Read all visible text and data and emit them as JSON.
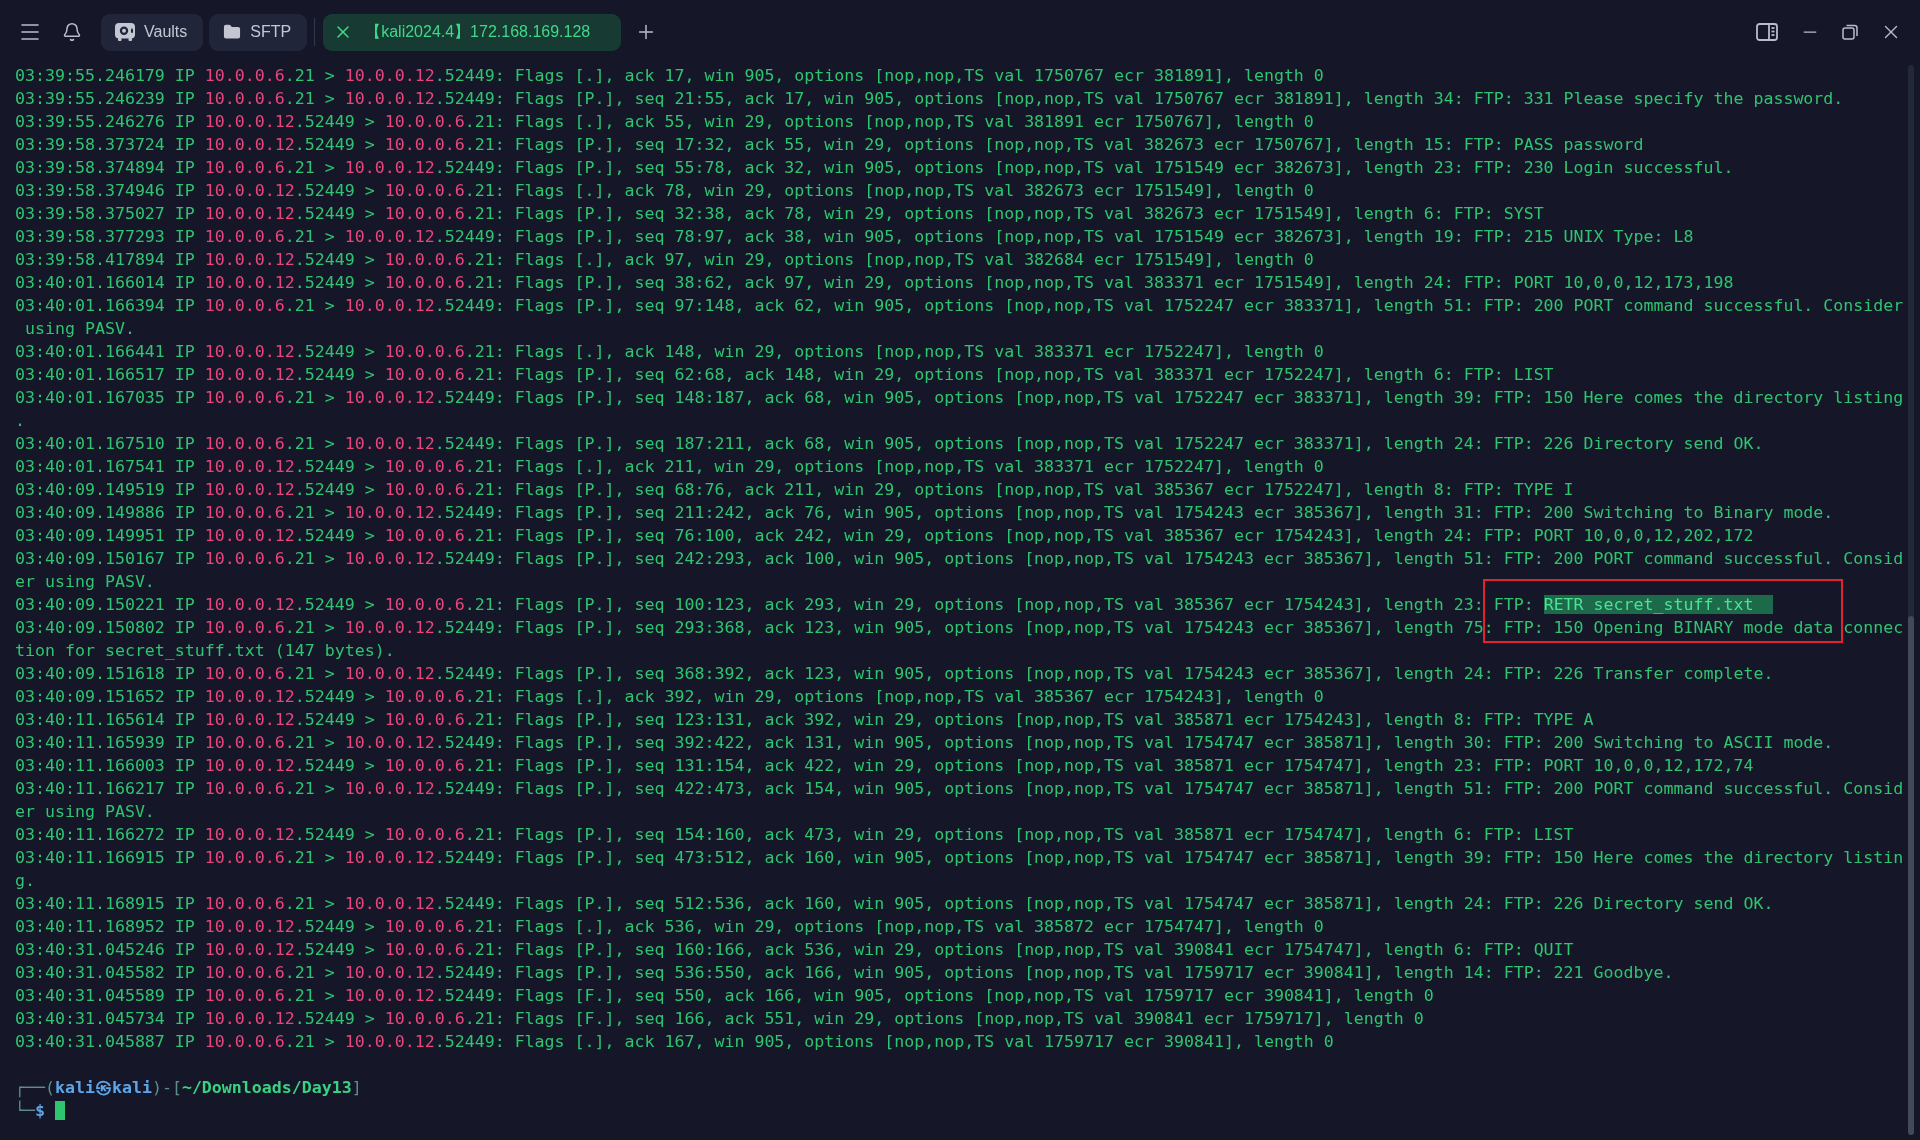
{
  "toolbar": {
    "buttons": [
      {
        "label": "Vaults",
        "kind": "vault"
      },
      {
        "label": "SFTP",
        "kind": "folder"
      }
    ]
  },
  "tabs": [
    {
      "label": "【kali2024.4】172.168.169.128",
      "selected": true
    }
  ],
  "terminal": {
    "lines": [
      {
        "time": "03:39:55.246179",
        "proto": "IP",
        "src_host": "10.0.0.6",
        "src_port": ".21",
        "arrow": ">",
        "dst_host": "10.0.0.12",
        "dst_port": ".52449:",
        "info": "Flags [.], ack 17, win 905, options [nop,nop,TS val 1750767 ecr 381891], length 0",
        "boxed": false
      },
      {
        "time": "03:39:55.246239",
        "proto": "IP",
        "src_host": "10.0.0.6",
        "src_port": ".21",
        "arrow": ">",
        "dst_host": "10.0.0.12",
        "dst_port": ".52449:",
        "info": "Flags [P.], seq 21:55, ack 17, win 905, options [nop,nop,TS val 1750767 ecr 381891], length 34: FTP: 331 Please specify the password.",
        "boxed": false
      },
      {
        "time": "03:39:55.246276",
        "proto": "IP",
        "src_host": "10.0.0.12",
        "src_port": ".52449",
        "arrow": ">",
        "dst_host": "10.0.0.6",
        "dst_port": ".21:",
        "info": "Flags [.], ack 55, win 29, options [nop,nop,TS val 381891 ecr 1750767], length 0",
        "boxed": false
      },
      {
        "time": "03:39:58.373724",
        "proto": "IP",
        "src_host": "10.0.0.12",
        "src_port": ".52449",
        "arrow": ">",
        "dst_host": "10.0.0.6",
        "dst_port": ".21:",
        "info": "Flags [P.], seq 17:32, ack 55, win 29, options [nop,nop,TS val 382673 ecr 1750767], length 15: FTP: PASS password",
        "boxed": false
      },
      {
        "time": "03:39:58.374894",
        "proto": "IP",
        "src_host": "10.0.0.6",
        "src_port": ".21",
        "arrow": ">",
        "dst_host": "10.0.0.12",
        "dst_port": ".52449:",
        "info": "Flags [P.], seq 55:78, ack 32, win 905, options [nop,nop,TS val 1751549 ecr 382673], length 23: FTP: 230 Login successful.",
        "boxed": false
      },
      {
        "time": "03:39:58.374946",
        "proto": "IP",
        "src_host": "10.0.0.12",
        "src_port": ".52449",
        "arrow": ">",
        "dst_host": "10.0.0.6",
        "dst_port": ".21:",
        "info": "Flags [.], ack 78, win 29, options [nop,nop,TS val 382673 ecr 1751549], length 0",
        "boxed": false
      },
      {
        "time": "03:39:58.375027",
        "proto": "IP",
        "src_host": "10.0.0.12",
        "src_port": ".52449",
        "arrow": ">",
        "dst_host": "10.0.0.6",
        "dst_port": ".21:",
        "info": "Flags [P.], seq 32:38, ack 78, win 29, options [nop,nop,TS val 382673 ecr 1751549], length 6: FTP: SYST",
        "boxed": false
      },
      {
        "time": "03:39:58.377293",
        "proto": "IP",
        "src_host": "10.0.0.6",
        "src_port": ".21",
        "arrow": ">",
        "dst_host": "10.0.0.12",
        "dst_port": ".52449:",
        "info": "Flags [P.], seq 78:97, ack 38, win 905, options [nop,nop,TS val 1751549 ecr 382673], length 19: FTP: 215 UNIX Type: L8",
        "boxed": false
      },
      {
        "time": "03:39:58.417894",
        "proto": "IP",
        "src_host": "10.0.0.12",
        "src_port": ".52449",
        "arrow": ">",
        "dst_host": "10.0.0.6",
        "dst_port": ".21:",
        "info": "Flags [.], ack 97, win 29, options [nop,nop,TS val 382684 ecr 1751549], length 0",
        "boxed": false
      },
      {
        "time": "03:40:01.166014",
        "proto": "IP",
        "src_host": "10.0.0.12",
        "src_port": ".52449",
        "arrow": ">",
        "dst_host": "10.0.0.6",
        "dst_port": ".21:",
        "info": "Flags [P.], seq 38:62, ack 97, win 29, options [nop,nop,TS val 383371 ecr 1751549], length 24: FTP: PORT 10,0,0,12,173,198",
        "boxed": false
      },
      {
        "time": "03:40:01.166394",
        "proto": "IP",
        "src_host": "10.0.0.6",
        "src_port": ".21",
        "arrow": ">",
        "dst_host": "10.0.0.12",
        "dst_port": ".52449:",
        "info": "Flags [P.], seq 97:148, ack 62, win 905, options [nop,nop,TS val 1752247 ecr 383371], length 51: FTP: 200 PORT command successful. Consider using PASV.",
        "boxed": false
      },
      {
        "time": "03:40:01.166441",
        "proto": "IP",
        "src_host": "10.0.0.12",
        "src_port": ".52449",
        "arrow": ">",
        "dst_host": "10.0.0.6",
        "dst_port": ".21:",
        "info": "Flags [.], ack 148, win 29, options [nop,nop,TS val 383371 ecr 1752247], length 0",
        "boxed": false
      },
      {
        "time": "03:40:01.166517",
        "proto": "IP",
        "src_host": "10.0.0.12",
        "src_port": ".52449",
        "arrow": ">",
        "dst_host": "10.0.0.6",
        "dst_port": ".21:",
        "info": "Flags [P.], seq 62:68, ack 148, win 29, options [nop,nop,TS val 383371 ecr 1752247], length 6: FTP: LIST",
        "boxed": false
      },
      {
        "time": "03:40:01.167035",
        "proto": "IP",
        "src_host": "10.0.0.6",
        "src_port": ".21",
        "arrow": ">",
        "dst_host": "10.0.0.12",
        "dst_port": ".52449:",
        "info": "Flags [P.], seq 148:187, ack 68, win 905, options [nop,nop,TS val 1752247 ecr 383371], length 39: FTP: 150 Here comes the directory listing.",
        "boxed": false
      },
      {
        "time": "03:40:01.167510",
        "proto": "IP",
        "src_host": "10.0.0.6",
        "src_port": ".21",
        "arrow": ">",
        "dst_host": "10.0.0.12",
        "dst_port": ".52449:",
        "info": "Flags [P.], seq 187:211, ack 68, win 905, options [nop,nop,TS val 1752247 ecr 383371], length 24: FTP: 226 Directory send OK.",
        "boxed": false
      },
      {
        "time": "03:40:01.167541",
        "proto": "IP",
        "src_host": "10.0.0.12",
        "src_port": ".52449",
        "arrow": ">",
        "dst_host": "10.0.0.6",
        "dst_port": ".21:",
        "info": "Flags [.], ack 211, win 29, options [nop,nop,TS val 383371 ecr 1752247], length 0",
        "boxed": false
      },
      {
        "time": "03:40:09.149519",
        "proto": "IP",
        "src_host": "10.0.0.12",
        "src_port": ".52449",
        "arrow": ">",
        "dst_host": "10.0.0.6",
        "dst_port": ".21:",
        "info": "Flags [P.], seq 68:76, ack 211, win 29, options [nop,nop,TS val 385367 ecr 1752247], length 8: FTP: TYPE I",
        "boxed": false
      },
      {
        "time": "03:40:09.149886",
        "proto": "IP",
        "src_host": "10.0.0.6",
        "src_port": ".21",
        "arrow": ">",
        "dst_host": "10.0.0.12",
        "dst_port": ".52449:",
        "info": "Flags [P.], seq 211:242, ack 76, win 905, options [nop,nop,TS val 1754243 ecr 385367], length 31: FTP: 200 Switching to Binary mode.",
        "boxed": false
      },
      {
        "time": "03:40:09.149951",
        "proto": "IP",
        "src_host": "10.0.0.12",
        "src_port": ".52449",
        "arrow": ">",
        "dst_host": "10.0.0.6",
        "dst_port": ".21:",
        "info": "Flags [P.], seq 76:100, ack 242, win 29, options [nop,nop,TS val 385367 ecr 1754243], length 24: FTP: PORT 10,0,0,12,202,172",
        "boxed": false
      },
      {
        "time": "03:40:09.150167",
        "proto": "IP",
        "src_host": "10.0.0.6",
        "src_port": ".21",
        "arrow": ">",
        "dst_host": "10.0.0.12",
        "dst_port": ".52449:",
        "info": "Flags [P.], seq 242:293, ack 100, win 905, options [nop,nop,TS val 1754243 ecr 385367], length 51: FTP: 200 PORT command successful. Consider using PASV.",
        "boxed": false
      },
      {
        "time": "03:40:09.150221",
        "proto": "IP",
        "src_host": "10.0.0.12",
        "src_port": ".52449",
        "arrow": ">",
        "dst_host": "10.0.0.6",
        "dst_port": ".21:",
        "info": "Flags [P.], seq 100:123, ack 293, win 29, options [nop,nop,TS val 385367 ecr 1754243], length 23: FTP:",
        "selected_text": "RETR secret_stuff.txt",
        "boxed": true
      },
      {
        "time": "03:40:09.150802",
        "proto": "IP",
        "src_host": "10.0.0.6",
        "src_port": ".21",
        "arrow": ">",
        "dst_host": "10.0.0.12",
        "dst_port": ".52449:",
        "info": "Flags [P.], seq 293:368, ack 123, win 905, options [nop,nop,TS val 1754243 ecr 385367], length 75: FTP: 150 Opening BINARY mode data connection for secret_stuff.txt (147 bytes).",
        "boxed": true
      },
      {
        "time": "03:40:09.151618",
        "proto": "IP",
        "src_host": "10.0.0.6",
        "src_port": ".21",
        "arrow": ">",
        "dst_host": "10.0.0.12",
        "dst_port": ".52449:",
        "info": "Flags [P.], seq 368:392, ack 123, win 905, options [nop,nop,TS val 1754243 ecr 385367], length 24: FTP: 226 Transfer complete.",
        "boxed": false
      },
      {
        "time": "03:40:09.151652",
        "proto": "IP",
        "src_host": "10.0.0.12",
        "src_port": ".52449",
        "arrow": ">",
        "dst_host": "10.0.0.6",
        "dst_port": ".21:",
        "info": "Flags [.], ack 392, win 29, options [nop,nop,TS val 385367 ecr 1754243], length 0",
        "boxed": false
      },
      {
        "time": "03:40:11.165614",
        "proto": "IP",
        "src_host": "10.0.0.12",
        "src_port": ".52449",
        "arrow": ">",
        "dst_host": "10.0.0.6",
        "dst_port": ".21:",
        "info": "Flags [P.], seq 123:131, ack 392, win 29, options [nop,nop,TS val 385871 ecr 1754243], length 8: FTP: TYPE A",
        "boxed": false
      },
      {
        "time": "03:40:11.165939",
        "proto": "IP",
        "src_host": "10.0.0.6",
        "src_port": ".21",
        "arrow": ">",
        "dst_host": "10.0.0.12",
        "dst_port": ".52449:",
        "info": "Flags [P.], seq 392:422, ack 131, win 905, options [nop,nop,TS val 1754747 ecr 385871], length 30: FTP: 200 Switching to ASCII mode.",
        "boxed": false
      },
      {
        "time": "03:40:11.166003",
        "proto": "IP",
        "src_host": "10.0.0.12",
        "src_port": ".52449",
        "arrow": ">",
        "dst_host": "10.0.0.6",
        "dst_port": ".21:",
        "info": "Flags [P.], seq 131:154, ack 422, win 29, options [nop,nop,TS val 385871 ecr 1754747], length 23: FTP: PORT 10,0,0,12,172,74",
        "boxed": false
      },
      {
        "time": "03:40:11.166217",
        "proto": "IP",
        "src_host": "10.0.0.6",
        "src_port": ".21",
        "arrow": ">",
        "dst_host": "10.0.0.12",
        "dst_port": ".52449:",
        "info": "Flags [P.], seq 422:473, ack 154, win 905, options [nop,nop,TS val 1754747 ecr 385871], length 51: FTP: 200 PORT command successful. Consider using PASV.",
        "boxed": false
      },
      {
        "time": "03:40:11.166272",
        "proto": "IP",
        "src_host": "10.0.0.12",
        "src_port": ".52449",
        "arrow": ">",
        "dst_host": "10.0.0.6",
        "dst_port": ".21:",
        "info": "Flags [P.], seq 154:160, ack 473, win 29, options [nop,nop,TS val 385871 ecr 1754747], length 6: FTP: LIST",
        "boxed": false
      },
      {
        "time": "03:40:11.166915",
        "proto": "IP",
        "src_host": "10.0.0.6",
        "src_port": ".21",
        "arrow": ">",
        "dst_host": "10.0.0.12",
        "dst_port": ".52449:",
        "info": "Flags [P.], seq 473:512, ack 160, win 905, options [nop,nop,TS val 1754747 ecr 385871], length 39: FTP: 150 Here comes the directory listing.",
        "boxed": false
      },
      {
        "time": "03:40:11.168915",
        "proto": "IP",
        "src_host": "10.0.0.6",
        "src_port": ".21",
        "arrow": ">",
        "dst_host": "10.0.0.12",
        "dst_port": ".52449:",
        "info": "Flags [P.], seq 512:536, ack 160, win 905, options [nop,nop,TS val 1754747 ecr 385871], length 24: FTP: 226 Directory send OK.",
        "boxed": false
      },
      {
        "time": "03:40:11.168952",
        "proto": "IP",
        "src_host": "10.0.0.12",
        "src_port": ".52449",
        "arrow": ">",
        "dst_host": "10.0.0.6",
        "dst_port": ".21:",
        "info": "Flags [.], ack 536, win 29, options [nop,nop,TS val 385872 ecr 1754747], length 0",
        "boxed": false
      },
      {
        "time": "03:40:31.045246",
        "proto": "IP",
        "src_host": "10.0.0.12",
        "src_port": ".52449",
        "arrow": ">",
        "dst_host": "10.0.0.6",
        "dst_port": ".21:",
        "info": "Flags [P.], seq 160:166, ack 536, win 29, options [nop,nop,TS val 390841 ecr 1754747], length 6: FTP: QUIT",
        "boxed": false
      },
      {
        "time": "03:40:31.045582",
        "proto": "IP",
        "src_host": "10.0.0.6",
        "src_port": ".21",
        "arrow": ">",
        "dst_host": "10.0.0.12",
        "dst_port": ".52449:",
        "info": "Flags [P.], seq 536:550, ack 166, win 905, options [nop,nop,TS val 1759717 ecr 390841], length 14: FTP: 221 Goodbye.",
        "boxed": false
      },
      {
        "time": "03:40:31.045589",
        "proto": "IP",
        "src_host": "10.0.0.6",
        "src_port": ".21",
        "arrow": ">",
        "dst_host": "10.0.0.12",
        "dst_port": ".52449:",
        "info": "Flags [F.], seq 550, ack 166, win 905, options [nop,nop,TS val 1759717 ecr 390841], length 0",
        "boxed": false
      },
      {
        "time": "03:40:31.045734",
        "proto": "IP",
        "src_host": "10.0.0.12",
        "src_port": ".52449",
        "arrow": ">",
        "dst_host": "10.0.0.6",
        "dst_port": ".21:",
        "info": "Flags [F.], seq 166, ack 551, win 29, options [nop,nop,TS val 390841 ecr 1759717], length 0",
        "boxed": false
      },
      {
        "time": "03:40:31.045887",
        "proto": "IP",
        "src_host": "10.0.0.6",
        "src_port": ".21",
        "arrow": ">",
        "dst_host": "10.0.0.12",
        "dst_port": ".52449:",
        "info": "Flags [.], ack 167, win 905, options [nop,nop,TS val 1759717 ecr 390841], length 0",
        "boxed": false
      }
    ],
    "prompt": {
      "frame_start": "┌──(",
      "user_host": "kali㉿kali",
      "frame_middle": ")-[",
      "path": "~/Downloads/Day13",
      "frame_end": "]",
      "frame_bottom": "└─",
      "symbol": "$"
    }
  }
}
